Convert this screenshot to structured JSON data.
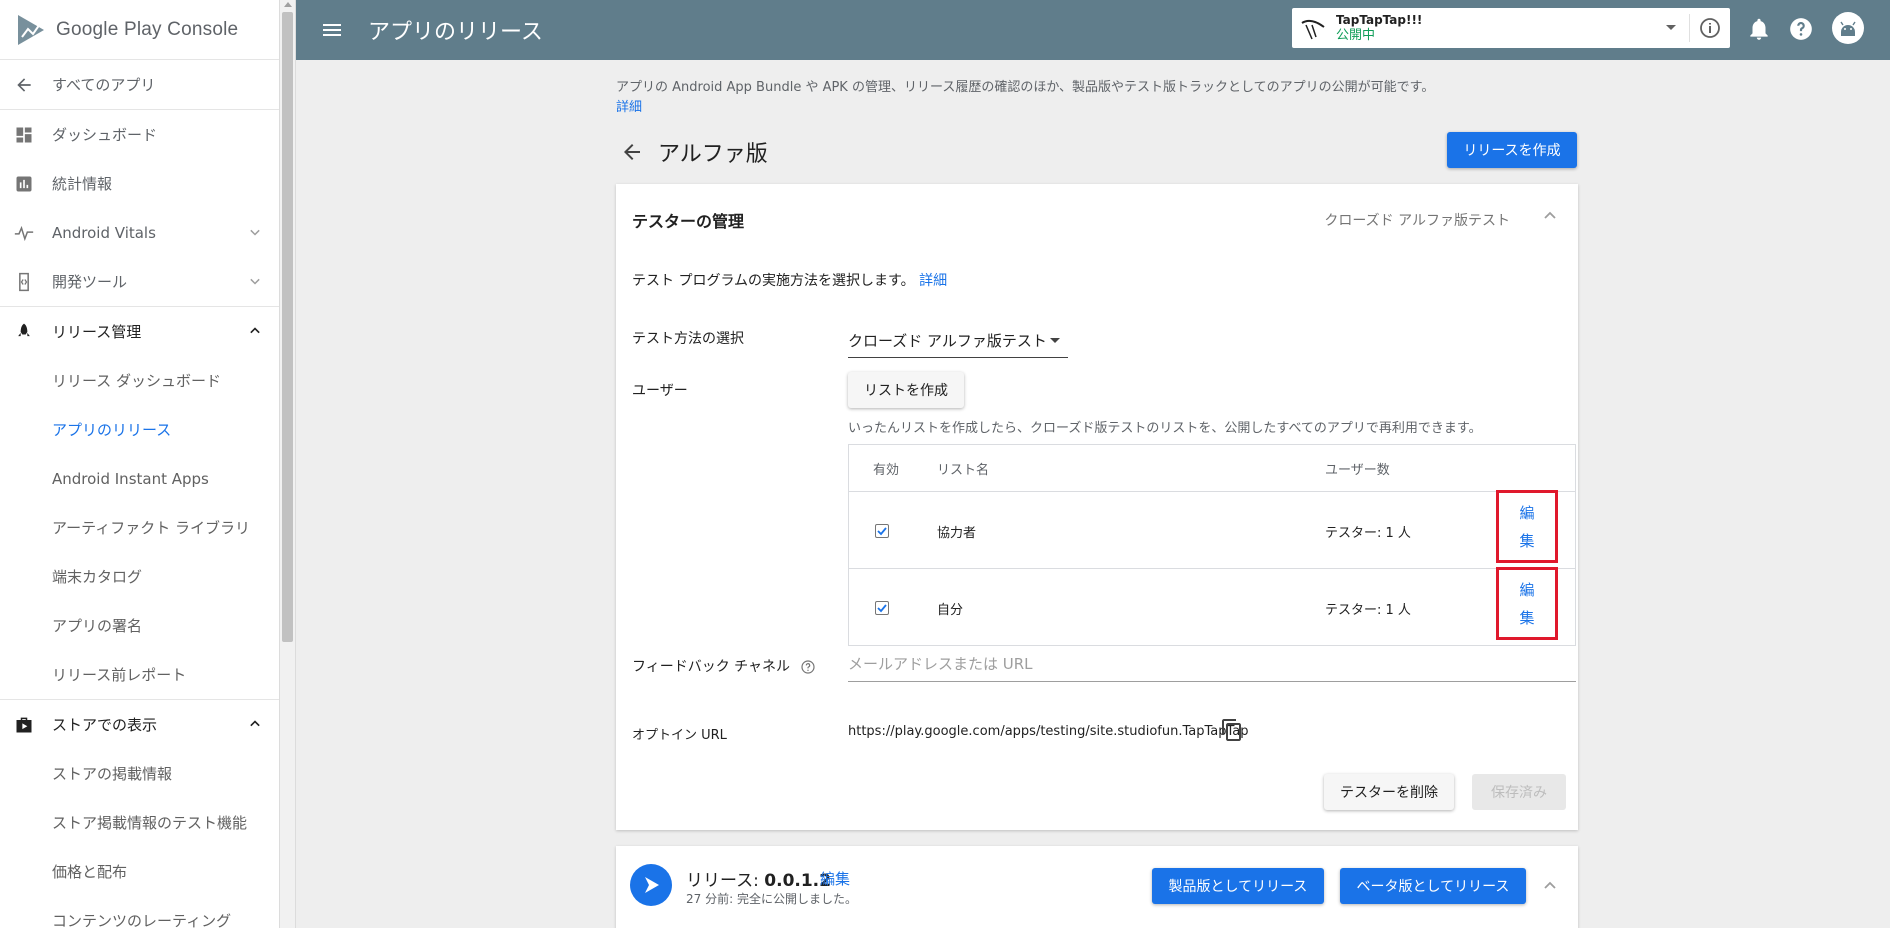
{
  "sidebar": {
    "brand": "Google Play Console",
    "back_label": "すべてのアプリ",
    "items": [
      {
        "label": "ダッシュボード"
      },
      {
        "label": "統計情報"
      },
      {
        "label": "Android Vitals"
      },
      {
        "label": "開発ツール"
      },
      {
        "label": "リリース管理"
      },
      {
        "label": "リリース ダッシュボード"
      },
      {
        "label": "アプリのリリース"
      },
      {
        "label": "Android Instant Apps"
      },
      {
        "label": "アーティファクト ライブラリ"
      },
      {
        "label": "端末カタログ"
      },
      {
        "label": "アプリの署名"
      },
      {
        "label": "リリース前レポート"
      },
      {
        "label": "ストアでの表示"
      },
      {
        "label": "ストアの掲載情報"
      },
      {
        "label": "ストア掲載情報のテスト機能"
      },
      {
        "label": "価格と配布"
      },
      {
        "label": "コンテンツのレーティング"
      }
    ]
  },
  "topbar": {
    "title": "アプリのリリース",
    "app_name": "TapTapTap!!!",
    "app_status": "公開中",
    "status_color": "#0f9d58",
    "bar_color": "#607d8b"
  },
  "main": {
    "intro_text": "アプリの Android App Bundle や APK の管理、リリース履歴の確認のほか、製品版やテスト版トラックとしてのアプリの公開が可能です。",
    "intro_link": "詳細",
    "track_title": "アルファ版",
    "create_release_label": "リリースを作成"
  },
  "tester_card": {
    "title": "テスターの管理",
    "meta": "クローズド アルファ版テスト",
    "description": "テスト プログラムの実施方法を選択します。",
    "description_link": "詳細",
    "method_label": "テスト方法の選択",
    "method_value": "クローズド アルファ版テスト",
    "users_label": "ユーザー",
    "create_list_label": "リストを作成",
    "hint": "いったんリストを作成したら、クローズド版テストのリストを、公開したすべてのアプリで再利用できます。",
    "table": {
      "headers": [
        "有効",
        "リスト名",
        "ユーザー数"
      ],
      "rows": [
        {
          "name": "協力者",
          "count": "テスター: 1 人",
          "edit_1": "編",
          "edit_2": "集"
        },
        {
          "name": "自分",
          "count": "テスター: 1 人",
          "edit_1": "編",
          "edit_2": "集"
        }
      ]
    },
    "feedback_label": "フィードバック チャネル",
    "feedback_placeholder": "メールアドレスまたは URL",
    "optin_label": "オプトイン URL",
    "optin_url": "https://play.google.com/apps/testing/site.studiofun.TapTapTap",
    "delete_label": "テスターを削除",
    "saved_label": "保存済み"
  },
  "release_card": {
    "title_prefix": "リリース: ",
    "version": "0.0.1.2",
    "edit_label": "編集",
    "subtitle": "27 分前: 完全に公開しました。",
    "prod_label": "製品版としてリリース",
    "beta_label": "ベータ版としてリリース"
  }
}
